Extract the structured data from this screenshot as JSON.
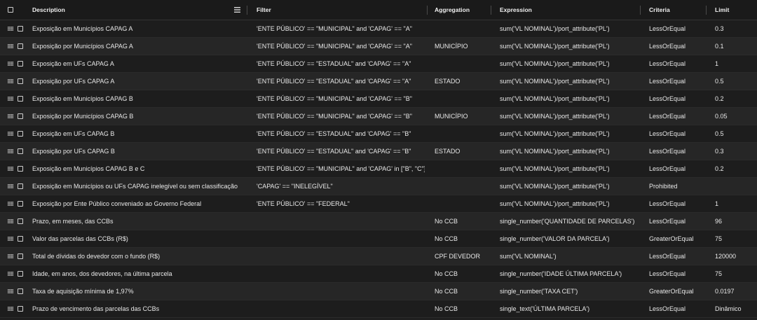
{
  "header": {
    "description": "Description",
    "filter": "Filter",
    "aggregation": "Aggregation",
    "expression": "Expression",
    "criteria": "Criteria",
    "limit": "Limit",
    "menu_icon": "menu-icon"
  },
  "rows": [
    {
      "description": "Exposição em Municípios CAPAG A",
      "filter": "'ENTE PÚBLICO' == \"MUNICIPAL\" and 'CAPAG' == \"A\"",
      "aggregation": "",
      "expression": "sum('VL NOMINAL')/port_attribute('PL')",
      "criteria": "LessOrEqual",
      "limit": "0.3"
    },
    {
      "description": "Exposição por Municípios CAPAG A",
      "filter": "'ENTE PÚBLICO' == \"MUNICIPAL\" and 'CAPAG' == \"A\"",
      "aggregation": "MUNICÍPIO",
      "expression": "sum('VL NOMINAL')/port_attribute('PL')",
      "criteria": "LessOrEqual",
      "limit": "0.1"
    },
    {
      "description": "Exposição em UFs CAPAG A",
      "filter": "'ENTE PÚBLICO' == \"ESTADUAL\" and 'CAPAG' == \"A\"",
      "aggregation": "",
      "expression": "sum('VL NOMINAL')/port_attribute('PL')",
      "criteria": "LessOrEqual",
      "limit": "1"
    },
    {
      "description": "Exposição por UFs CAPAG A",
      "filter": "'ENTE PÚBLICO' == \"ESTADUAL\" and 'CAPAG' == \"A\"",
      "aggregation": "ESTADO",
      "expression": "sum('VL NOMINAL')/port_attribute('PL')",
      "criteria": "LessOrEqual",
      "limit": "0.5"
    },
    {
      "description": "Exposição em Municípios CAPAG B",
      "filter": "'ENTE PÚBLICO' == \"MUNICIPAL\" and 'CAPAG' == \"B\"",
      "aggregation": "",
      "expression": "sum('VL NOMINAL')/port_attribute('PL')",
      "criteria": "LessOrEqual",
      "limit": "0.2"
    },
    {
      "description": "Exposição por Municípios CAPAG B",
      "filter": "'ENTE PÚBLICO' == \"MUNICIPAL\" and 'CAPAG' == \"B\"",
      "aggregation": "MUNICÍPIO",
      "expression": "sum('VL NOMINAL')/port_attribute('PL')",
      "criteria": "LessOrEqual",
      "limit": "0.05"
    },
    {
      "description": "Exposição em UFs CAPAG B",
      "filter": "'ENTE PÚBLICO' == \"ESTADUAL\" and 'CAPAG' == \"B\"",
      "aggregation": "",
      "expression": "sum('VL NOMINAL')/port_attribute('PL')",
      "criteria": "LessOrEqual",
      "limit": "0.5"
    },
    {
      "description": "Exposição por UFs CAPAG B",
      "filter": "'ENTE PÚBLICO' == \"ESTADUAL\" and 'CAPAG' == \"B\"",
      "aggregation": "ESTADO",
      "expression": "sum('VL NOMINAL')/port_attribute('PL')",
      "criteria": "LessOrEqual",
      "limit": "0.3"
    },
    {
      "description": "Exposição em Municípios CAPAG B e C",
      "filter": "'ENTE PÚBLICO' == \"MUNICIPAL\" and 'CAPAG' in [\"B\", \"C\"]",
      "aggregation": "",
      "expression": "sum('VL NOMINAL')/port_attribute('PL')",
      "criteria": "LessOrEqual",
      "limit": "0.2"
    },
    {
      "description": "Exposição em Municípios ou UFs CAPAG inelegível ou sem classificação",
      "filter": "'CAPAG' == \"INELEGÍVEL\"",
      "aggregation": "",
      "expression": "sum('VL NOMINAL')/port_attribute('PL')",
      "criteria": "Prohibited",
      "limit": ""
    },
    {
      "description": "Exposição por Ente Público conveniado ao Governo Federal",
      "filter": "'ENTE PÚBLICO' == \"FEDERAL\"",
      "aggregation": "",
      "expression": "sum('VL NOMINAL')/port_attribute('PL')",
      "criteria": "LessOrEqual",
      "limit": "1"
    },
    {
      "description": "Prazo, em meses, das CCBs",
      "filter": "",
      "aggregation": "No CCB",
      "expression": "single_number('QUANTIDADE DE PARCELAS')",
      "criteria": "LessOrEqual",
      "limit": "96"
    },
    {
      "description": "Valor das parcelas das CCBs (R$)",
      "filter": "",
      "aggregation": "No CCB",
      "expression": "single_number('VALOR DA PARCELA')",
      "criteria": "GreaterOrEqual",
      "limit": "75"
    },
    {
      "description": "Total de dívidas do devedor com o fundo (R$)",
      "filter": "",
      "aggregation": "CPF DEVEDOR",
      "expression": "sum('VL NOMINAL')",
      "criteria": "LessOrEqual",
      "limit": "120000"
    },
    {
      "description": "Idade, em anos, dos devedores, na última parcela",
      "filter": "",
      "aggregation": "No CCB",
      "expression": "single_number('IDADE ÚLTIMA PARCELA')",
      "criteria": "LessOrEqual",
      "limit": "75"
    },
    {
      "description": "Taxa de aquisição mínima de 1,97%",
      "filter": "",
      "aggregation": "No CCB",
      "expression": "single_number('TAXA CET')",
      "criteria": "GreaterOrEqual",
      "limit": "0.0197"
    },
    {
      "description": "Prazo de vencimento das parcelas das CCBs",
      "filter": "",
      "aggregation": "No CCB",
      "expression": "single_text('ÚLTIMA PARCELA')",
      "criteria": "LessOrEqual",
      "limit": "Dinâmico"
    }
  ]
}
